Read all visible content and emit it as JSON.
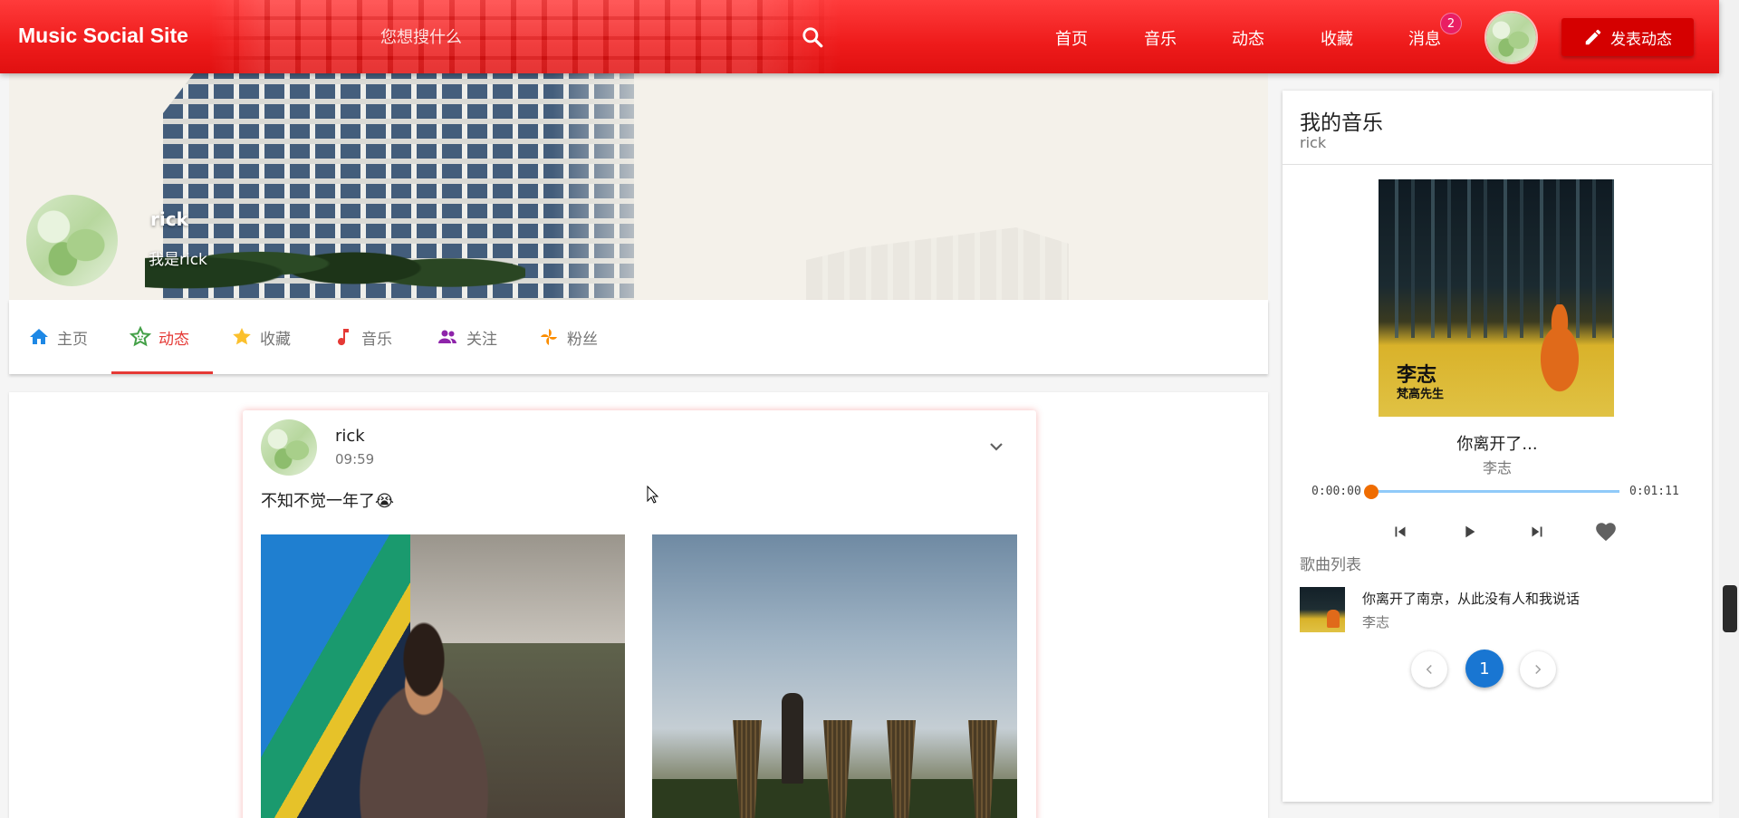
{
  "topbar": {
    "site_title": "Music Social Site",
    "search_placeholder": "您想搜什么",
    "nav": [
      "首页",
      "音乐",
      "动态",
      "收藏",
      "消息"
    ],
    "message_badge": "2",
    "post_button": "发表动态",
    "brand_color": "#e53935"
  },
  "profile": {
    "name": "rick",
    "bio": "我是rick"
  },
  "tabs": [
    {
      "label": "主页",
      "icon": "home-icon",
      "color": "#1e88e5"
    },
    {
      "label": "动态",
      "icon": "star-face-icon",
      "color": "#43a047",
      "active": true
    },
    {
      "label": "收藏",
      "icon": "star-icon",
      "color": "#fbc02d"
    },
    {
      "label": "音乐",
      "icon": "music-note-icon",
      "color": "#e53935"
    },
    {
      "label": "关注",
      "icon": "people-icon",
      "color": "#8e24aa"
    },
    {
      "label": "粉丝",
      "icon": "pinwheel-icon",
      "color": "#fb8c00"
    }
  ],
  "post": {
    "user": "rick",
    "time": "09:59",
    "text": "不知不觉一年了😭"
  },
  "music": {
    "title": "我的音乐",
    "owner": "rick",
    "album_artist_text": "李志",
    "album_title_text": "梵高先生",
    "song_title": "你离开了...",
    "song_artist": "李志",
    "time_current": "0:00:00",
    "time_total": "0:01:11",
    "progress": 0,
    "playlist_label": "歌曲列表",
    "playlist": [
      {
        "title": "你离开了南京，从此没有人和我说话",
        "artist": "李志"
      }
    ],
    "pagination": {
      "current": "1"
    }
  }
}
